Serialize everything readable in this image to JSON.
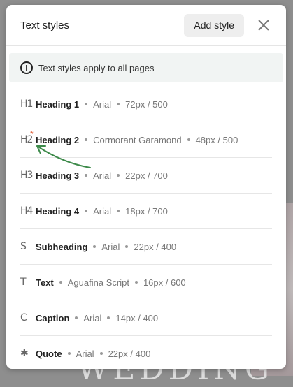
{
  "modal": {
    "title": "Text styles",
    "add_label": "Add style",
    "info_icon": "i",
    "info_text": "Text styles apply to all pages"
  },
  "styles": [
    {
      "glyph": "H1",
      "icon": "heading-1-icon",
      "name": "Heading 1",
      "font": "Arial",
      "size": "72px / 500"
    },
    {
      "glyph": "H2",
      "icon": "heading-2-icon",
      "name": "Heading 2",
      "font": "Cormorant Garamond",
      "size": "48px / 500",
      "star": "*"
    },
    {
      "glyph": "H3",
      "icon": "heading-3-icon",
      "name": "Heading 3",
      "font": "Arial",
      "size": "22px / 700"
    },
    {
      "glyph": "H4",
      "icon": "heading-4-icon",
      "name": "Heading 4",
      "font": "Arial",
      "size": "18px / 700"
    },
    {
      "glyph": "S",
      "icon": "subheading-icon",
      "name": "Subheading",
      "font": "Arial",
      "size": "22px / 400"
    },
    {
      "glyph": "T",
      "icon": "text-icon",
      "name": "Text",
      "font": "Aguafina Script",
      "size": "16px / 600"
    },
    {
      "glyph": "C",
      "icon": "caption-icon",
      "name": "Caption",
      "font": "Arial",
      "size": "14px / 400"
    },
    {
      "glyph": "✱",
      "icon": "quote-icon",
      "name": "Quote",
      "font": "Arial",
      "size": "22px / 400"
    }
  ],
  "colors": {
    "accent_star": "#e0603a",
    "annotation_arrow": "#3d8a4a"
  }
}
